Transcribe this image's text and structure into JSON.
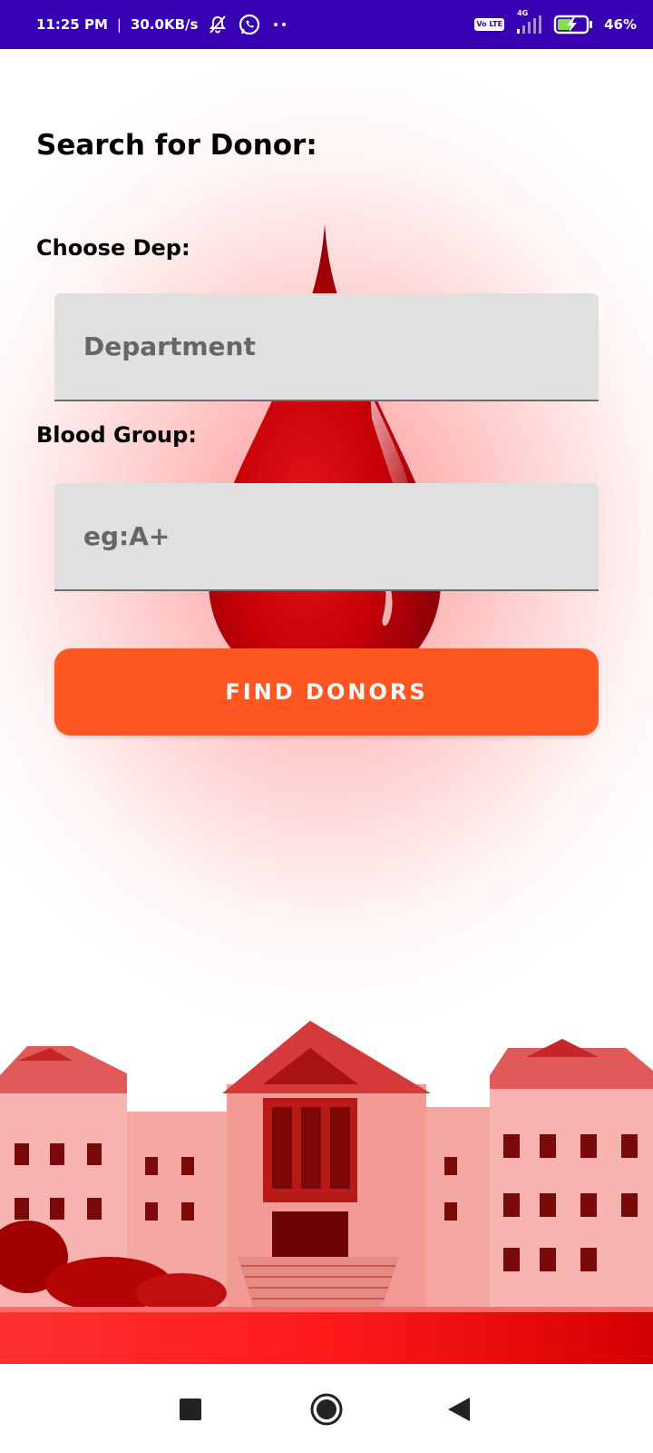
{
  "status_bar": {
    "time": "11:25 PM",
    "separator": "|",
    "network_speed": "30.0KB/s",
    "left_icons": [
      "mute-icon",
      "whatsapp-icon",
      "more-notifications-icon"
    ],
    "volte_label": "Vo LTE",
    "network_type": "4G",
    "battery_percent": "46%",
    "battery_level": 0.46,
    "background_color": "#3700b3"
  },
  "page": {
    "title": "Search for Donor:",
    "department_label": "Choose Dep:",
    "department_placeholder": "Department",
    "department_value": "",
    "blood_group_label": "Blood Group:",
    "blood_group_placeholder": "eg:A+",
    "blood_group_value": "",
    "find_button_label": "FIND DONORS",
    "accent_color": "#ff5722",
    "input_background": "#e0e0e0"
  },
  "decorations": [
    "blood-drop-image",
    "hospital-campus-image"
  ],
  "nav_bar": {
    "icons": [
      "recent-apps-icon",
      "home-icon",
      "back-icon"
    ]
  }
}
